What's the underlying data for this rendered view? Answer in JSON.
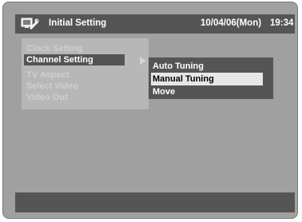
{
  "header": {
    "title": "Initial Setting",
    "date": "10/04/06(Mon)",
    "time": "19:34",
    "icon": "setup-wrench-icon"
  },
  "menu": {
    "items": [
      {
        "label": "Clock Setting",
        "selected": false
      },
      {
        "label": "Channel Setting",
        "selected": true
      },
      {
        "label": "TV Aspect",
        "selected": false
      },
      {
        "label": "Select Video",
        "selected": false
      },
      {
        "label": "Video Out",
        "selected": false
      }
    ],
    "arrow_icon": "triangle-right-icon"
  },
  "submenu": {
    "items": [
      {
        "label": "Auto Tuning",
        "selected": false
      },
      {
        "label": "Manual Tuning",
        "selected": true
      },
      {
        "label": "Move",
        "selected": false
      }
    ]
  },
  "status_bar": {
    "text": ""
  },
  "colors": {
    "background": "#a0a0a0",
    "bar": "#555555",
    "menu_panel": "#b7b7b7",
    "highlight_dark": "#545454",
    "highlight_light": "#e6e6e6"
  }
}
